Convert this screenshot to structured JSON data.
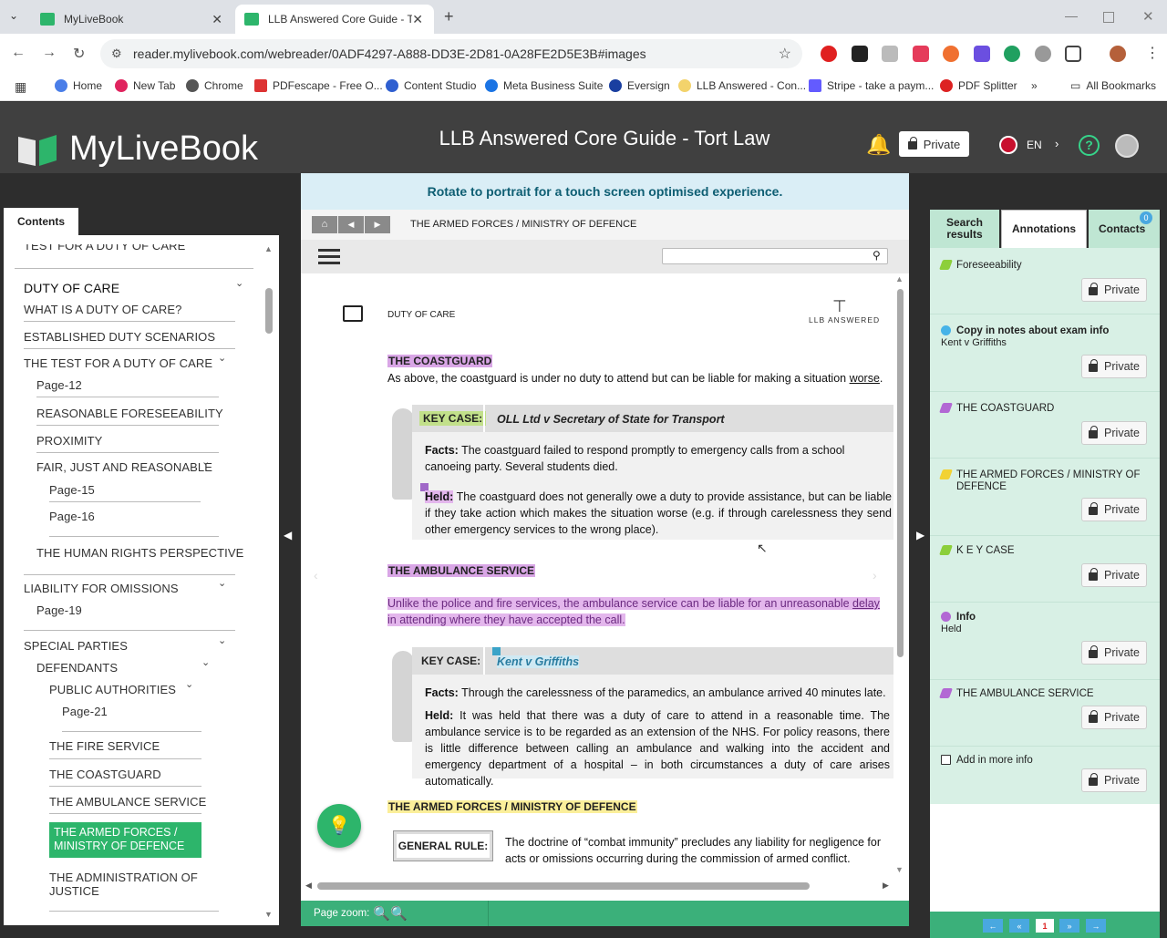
{
  "browser": {
    "tabs": [
      {
        "title": "MyLiveBook",
        "active": false
      },
      {
        "title": "LLB Answered Core Guide - Tort",
        "active": true
      }
    ],
    "url": "reader.mylivebook.com/webreader/0ADF4297-A888-DD3E-2D81-0A28FE2D5E3B#images",
    "bookmarks": [
      "Home",
      "New Tab",
      "Chrome",
      "PDFescape - Free O...",
      "Content Studio",
      "Meta Business Suite",
      "Eversign",
      "LLB Answered - Con...",
      "Stripe - take a paym...",
      "PDF Splitter"
    ],
    "more_bookmarks": "»",
    "all_bookmarks": "All Bookmarks"
  },
  "app": {
    "logo_text": "MyLiveBook",
    "book_title": "LLB Answered Core Guide - Tort Law",
    "privacy_button": "Private",
    "language": "EN",
    "help_icon": "?"
  },
  "contents": {
    "tab_label": "Contents",
    "items": [
      {
        "label": "TEST FOR A DUTY OF CARE"
      },
      {
        "label": "DUTY OF CARE"
      },
      {
        "label": "WHAT IS A DUTY OF CARE?"
      },
      {
        "label": "ESTABLISHED DUTY SCENARIOS"
      },
      {
        "label": "THE TEST FOR A DUTY OF CARE"
      },
      {
        "label": "Page-12"
      },
      {
        "label": "REASONABLE FORESEEABILITY"
      },
      {
        "label": "PROXIMITY"
      },
      {
        "label": "FAIR, JUST AND REASONABLE"
      },
      {
        "label": "Page-15"
      },
      {
        "label": "Page-16"
      },
      {
        "label": "THE HUMAN RIGHTS PERSPECTIVE"
      },
      {
        "label": "LIABILITY FOR OMISSIONS"
      },
      {
        "label": "Page-19"
      },
      {
        "label": "SPECIAL PARTIES"
      },
      {
        "label": "DEFENDANTS"
      },
      {
        "label": "PUBLIC AUTHORITIES"
      },
      {
        "label": "Page-21"
      },
      {
        "label": "THE FIRE SERVICE"
      },
      {
        "label": "THE COASTGUARD"
      },
      {
        "label": "THE AMBULANCE SERVICE"
      },
      {
        "label": "THE ARMED FORCES / MINISTRY OF DEFENCE"
      },
      {
        "label": "THE ADMINISTRATION OF JUSTICE"
      }
    ]
  },
  "reader": {
    "rotate_notice": "Rotate to portrait for a touch screen optimised experience.",
    "breadcrumb": "THE ARMED FORCES / MINISTRY OF DEFENCE",
    "search_placeholder": "",
    "page_zoom_label": "Page zoom:",
    "page": {
      "header_label": "DUTY OF CARE",
      "brand_label": "LLB ANSWERED",
      "coastguard_heading": "THE COASTGUARD",
      "coastguard_intro_pre": "As above, the coastguard is under no duty to attend but can be liable for making a situation ",
      "coastguard_intro_link": "worse",
      "coastguard_intro_post": ".",
      "keycase1": {
        "label": "KEY CASE:",
        "name": "OLL Ltd v Secretary of State for Transport",
        "facts_label": "Facts:",
        "facts": "The coastguard failed to respond promptly to emergency calls from a school canoeing party. Several students died.",
        "held_label": "Held:",
        "held": "The coastguard does not generally owe a duty to provide assistance, but can be liable if they take action which makes the situation worse (e.g. if through carelessness they send other emergency services to the wrong place)."
      },
      "ambulance_heading": "THE AMBULANCE SERVICE",
      "ambulance_intro_pre": "Unlike the police and fire services, the ambulance service can be liable for an unreasonable ",
      "ambulance_intro_link": "delay",
      "ambulance_intro_post": " in attending where they have accepted the call.",
      "keycase2": {
        "label": "KEY CASE:",
        "name": "Kent v Griffiths",
        "facts_label": "Facts:",
        "facts": "Through the carelessness of the paramedics, an ambulance arrived 40 minutes late.",
        "held_label": "Held:",
        "held": "It was held that there was a duty of care to attend in a reasonable time. The ambulance service is to be regarded as an extension of the NHS. For policy reasons, there is little difference between calling an ambulance and walking into the accident and emergency department of a hospital – in both circumstances a duty of care arises automatically."
      },
      "armed_heading": "THE ARMED FORCES / MINISTRY OF DEFENCE",
      "general_rule_label": "GENERAL RULE:",
      "general_rule": "The doctrine of “combat immunity” precludes any liability for negligence for acts or omissions occurring during the commission of armed conflict."
    }
  },
  "annotations": {
    "tabs": [
      "Search results",
      "Annotations",
      "Contacts"
    ],
    "contacts_badge": "0",
    "items": [
      {
        "title": "Foreseeability",
        "sub": "",
        "color": "#8ccf3a",
        "button": "Private"
      },
      {
        "title": "Copy in notes about exam info",
        "sub": "Kent v Griffiths",
        "color": "#47b3e8",
        "button": "Private"
      },
      {
        "title": "THE COASTGUARD",
        "sub": "",
        "color": "#b268d4",
        "button": "Private"
      },
      {
        "title": "THE ARMED FORCES / MINISTRY OF DEFENCE",
        "sub": "",
        "color": "#f2d233",
        "button": "Private"
      },
      {
        "title": "K E Y CASE",
        "sub": "",
        "color": "#8ccf3a",
        "button": "Private"
      },
      {
        "title": "Info",
        "sub": "Held",
        "color": "#b268d4",
        "button": "Private"
      },
      {
        "title": "THE AMBULANCE SERVICE",
        "sub": "",
        "color": "#b268d4",
        "button": "Private"
      },
      {
        "title": "Add in more info",
        "sub": "",
        "color": "#333333",
        "button": "Private"
      }
    ],
    "pager": {
      "first": "←",
      "prev": "«",
      "current": "1",
      "next": "»",
      "last": "→"
    }
  }
}
